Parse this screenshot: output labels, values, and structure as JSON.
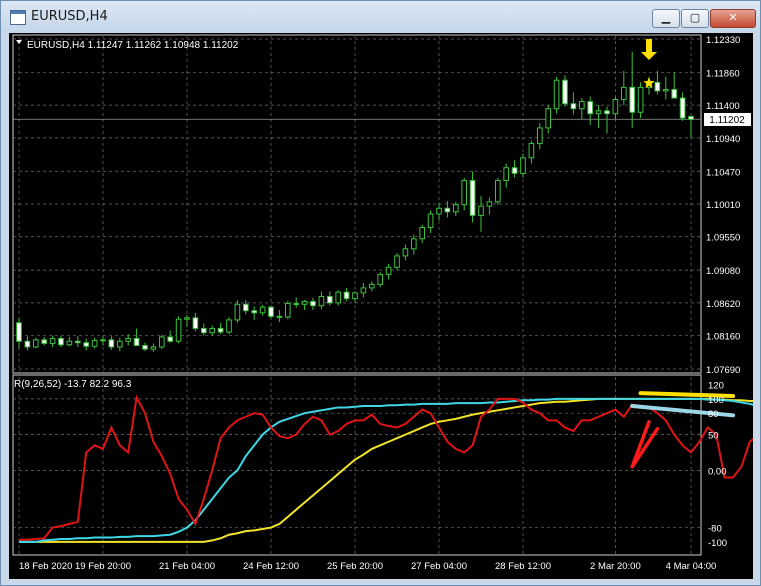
{
  "window": {
    "title": "EURUSD,H4",
    "buttons": {
      "minimize": "▁",
      "maximize": "▢",
      "close": "✕"
    }
  },
  "price_chart": {
    "info": "EURUSD,H4  1.11247 1.11262 1.10948 1.11202",
    "current_price": "1.11202",
    "axis_ticks": [
      "1.12330",
      "1.11860",
      "1.11400",
      "1.10940",
      "1.10470",
      "1.10010",
      "1.09550",
      "1.09080",
      "1.08620",
      "1.08160",
      "1.07690"
    ]
  },
  "indicator": {
    "label": "R(9,26,52) -13.7 82.2 96.3",
    "axis_ticks": [
      "120",
      "100",
      "80",
      "50",
      "0.00",
      "-80",
      "-100"
    ]
  },
  "time_axis": [
    "18 Feb 2020",
    "19 Feb 20:00",
    "21 Feb 04:00",
    "24 Feb 12:00",
    "25 Feb 20:00",
    "27 Feb 04:00",
    "28 Feb 12:00",
    "2 Mar 20:00",
    "4 Mar 04:00"
  ],
  "colors": {
    "background": "#000000",
    "grid": "#6f6f6f",
    "candles": "#3cc33c",
    "fast_line": "#e01414",
    "mid_line": "#3fd6e6",
    "slow_line": "#f0e32a",
    "annotation_yellow": "#ffe000",
    "annotation_blue": "#9cd7e8",
    "annotation_red": "#ff1a1a"
  },
  "chart_data": {
    "type": "line",
    "title": "EURUSD,H4",
    "ohlc_header": {
      "open": 1.11247,
      "high": 1.11262,
      "low": 1.10948,
      "close": 1.11202
    },
    "price_axis": {
      "ylim": [
        1.0769,
        1.1233
      ]
    },
    "candles": [
      [
        1.0834,
        1.0841,
        1.0798,
        1.0808
      ],
      [
        1.0808,
        1.0815,
        1.0795,
        1.08
      ],
      [
        1.08,
        1.0813,
        1.0798,
        1.081
      ],
      [
        1.081,
        1.0814,
        1.0802,
        1.0805
      ],
      [
        1.0805,
        1.0816,
        1.08,
        1.0812
      ],
      [
        1.0812,
        1.0816,
        1.08,
        1.0803
      ],
      [
        1.0803,
        1.0814,
        1.0801,
        1.0808
      ],
      [
        1.0808,
        1.0815,
        1.08,
        1.0806
      ],
      [
        1.0806,
        1.0812,
        1.0795,
        1.0801
      ],
      [
        1.0801,
        1.0813,
        1.0798,
        1.0809
      ],
      [
        1.0809,
        1.0815,
        1.0802,
        1.081
      ],
      [
        1.081,
        1.0815,
        1.0796,
        1.08
      ],
      [
        1.08,
        1.0813,
        1.0794,
        1.0808
      ],
      [
        1.0808,
        1.0818,
        1.0802,
        1.0812
      ],
      [
        1.0812,
        1.0826,
        1.0806,
        1.0802
      ],
      [
        1.0802,
        1.0806,
        1.0794,
        1.0797
      ],
      [
        1.0797,
        1.0805,
        1.0793,
        1.08
      ],
      [
        1.08,
        1.0817,
        1.0797,
        1.0814
      ],
      [
        1.0814,
        1.0823,
        1.0806,
        1.0808
      ],
      [
        1.0808,
        1.0843,
        1.0805,
        1.0839
      ],
      [
        1.0839,
        1.0845,
        1.0828,
        1.0841
      ],
      [
        1.0841,
        1.0848,
        1.0822,
        1.0826
      ],
      [
        1.0826,
        1.0833,
        1.0816,
        1.082
      ],
      [
        1.082,
        1.083,
        1.0816,
        1.0826
      ],
      [
        1.0826,
        1.0834,
        1.0818,
        1.0821
      ],
      [
        1.0821,
        1.0842,
        1.0818,
        1.0838
      ],
      [
        1.0838,
        1.0866,
        1.0834,
        1.086
      ],
      [
        1.086,
        1.0866,
        1.0846,
        1.0851
      ],
      [
        1.0851,
        1.0857,
        1.0838,
        1.0848
      ],
      [
        1.0848,
        1.0859,
        1.0844,
        1.0856
      ],
      [
        1.0856,
        1.0857,
        1.084,
        1.0843
      ],
      [
        1.0843,
        1.0852,
        1.0835,
        1.0842
      ],
      [
        1.0842,
        1.0865,
        1.0839,
        1.0861
      ],
      [
        1.0861,
        1.087,
        1.0855,
        1.086
      ],
      [
        1.086,
        1.0866,
        1.0852,
        1.0864
      ],
      [
        1.0864,
        1.0869,
        1.0852,
        1.0858
      ],
      [
        1.0858,
        1.0878,
        1.0853,
        1.0871
      ],
      [
        1.0871,
        1.0878,
        1.0858,
        1.0862
      ],
      [
        1.0862,
        1.088,
        1.0858,
        1.0877
      ],
      [
        1.0877,
        1.0883,
        1.0864,
        1.0868
      ],
      [
        1.0868,
        1.0878,
        1.0862,
        1.0876
      ],
      [
        1.0876,
        1.089,
        1.087,
        1.0883
      ],
      [
        1.0883,
        1.0892,
        1.0878,
        1.0888
      ],
      [
        1.0888,
        1.0905,
        1.0884,
        1.0902
      ],
      [
        1.0902,
        1.0917,
        1.0895,
        1.0912
      ],
      [
        1.0912,
        1.0932,
        1.0908,
        1.0928
      ],
      [
        1.0928,
        1.0944,
        1.0922,
        1.0938
      ],
      [
        1.0938,
        1.0958,
        1.093,
        1.0952
      ],
      [
        1.0952,
        1.0972,
        1.0946,
        1.0968
      ],
      [
        1.0968,
        1.0992,
        1.096,
        1.0987
      ],
      [
        1.0987,
        1.1003,
        1.0978,
        1.0995
      ],
      [
        1.0995,
        1.1005,
        1.0982,
        1.099
      ],
      [
        1.099,
        1.1004,
        1.0984,
        1.1
      ],
      [
        1.1,
        1.1038,
        1.0992,
        1.1034
      ],
      [
        1.1034,
        1.1047,
        1.0975,
        1.0985
      ],
      [
        1.0985,
        1.1012,
        1.0962,
        1.0998
      ],
      [
        1.0998,
        1.101,
        1.0986,
        1.1004
      ],
      [
        1.1004,
        1.1038,
        1.1,
        1.1034
      ],
      [
        1.1034,
        1.1058,
        1.1024,
        1.1052
      ],
      [
        1.1052,
        1.1063,
        1.1038,
        1.1044
      ],
      [
        1.1044,
        1.1072,
        1.1038,
        1.1066
      ],
      [
        1.1066,
        1.109,
        1.1058,
        1.1086
      ],
      [
        1.1086,
        1.1115,
        1.1078,
        1.1108
      ],
      [
        1.1108,
        1.114,
        1.11,
        1.1135
      ],
      [
        1.1135,
        1.118,
        1.1128,
        1.1175
      ],
      [
        1.1175,
        1.1182,
        1.1138,
        1.1142
      ],
      [
        1.1142,
        1.1158,
        1.1127,
        1.1135
      ],
      [
        1.1135,
        1.115,
        1.112,
        1.1145
      ],
      [
        1.1145,
        1.1152,
        1.1112,
        1.1128
      ],
      [
        1.1128,
        1.114,
        1.1108,
        1.1132
      ],
      [
        1.1132,
        1.1138,
        1.11,
        1.1128
      ],
      [
        1.1128,
        1.1152,
        1.112,
        1.1148
      ],
      [
        1.1148,
        1.1188,
        1.114,
        1.1165
      ],
      [
        1.1165,
        1.1215,
        1.1108,
        1.113
      ],
      [
        1.113,
        1.1172,
        1.1122,
        1.1165
      ],
      [
        1.1165,
        1.118,
        1.1155,
        1.1172
      ],
      [
        1.1172,
        1.1188,
        1.1155,
        1.116
      ],
      [
        1.116,
        1.118,
        1.1148,
        1.1162
      ],
      [
        1.1162,
        1.1186,
        1.115,
        1.115
      ],
      [
        1.115,
        1.1158,
        1.1118,
        1.1122
      ],
      [
        1.1124,
        1.1126,
        1.1095,
        1.112
      ]
    ],
    "indicator_axis": {
      "ylim": [
        -110,
        125
      ]
    },
    "series": [
      {
        "color": "#e01414",
        "values": [
          -97,
          -97,
          -96,
          -95,
          -80,
          -78,
          -75,
          -72,
          25,
          35,
          30,
          60,
          35,
          25,
          102,
          80,
          40,
          20,
          -5,
          -40,
          -55,
          -75,
          -40,
          0,
          45,
          60,
          70,
          75,
          80,
          78,
          60,
          48,
          45,
          50,
          65,
          75,
          70,
          50,
          55,
          65,
          70,
          70,
          78,
          65,
          62,
          60,
          65,
          75,
          85,
          80,
          60,
          40,
          30,
          25,
          35,
          75,
          85,
          100,
          100,
          100,
          95,
          85,
          80,
          70,
          70,
          60,
          55,
          70,
          70,
          75,
          80,
          85,
          75,
          92,
          90,
          88,
          80,
          70,
          50,
          35,
          25,
          40,
          60,
          50,
          -10,
          -10,
          5,
          40,
          50,
          48,
          45,
          25,
          -10
        ]
      },
      {
        "color": "#3fd6e6",
        "values": [
          -100,
          -100,
          -100,
          -98,
          -97,
          -96,
          -96,
          -95,
          -95,
          -94,
          -94,
          -94,
          -93,
          -93,
          -92,
          -92,
          -92,
          -91,
          -90,
          -86,
          -80,
          -70,
          -55,
          -40,
          -25,
          -10,
          0,
          20,
          35,
          50,
          60,
          68,
          72,
          76,
          80,
          82,
          84,
          86,
          88,
          88,
          89,
          90,
          90,
          90,
          91,
          91,
          92,
          92,
          93,
          93,
          93,
          93,
          94,
          94,
          94,
          94,
          95,
          95,
          96,
          97,
          98,
          98,
          99,
          99,
          100,
          100,
          100,
          100,
          100,
          100,
          100,
          100,
          100,
          100,
          100,
          100,
          100,
          100,
          100,
          100,
          100,
          100,
          99,
          99,
          98,
          97,
          95,
          93,
          90,
          85,
          82
        ]
      },
      {
        "color": "#f0e32a",
        "values": [
          -100,
          -100,
          -100,
          -100,
          -100,
          -100,
          -100,
          -100,
          -100,
          -100,
          -100,
          -100,
          -100,
          -100,
          -100,
          -100,
          -100,
          -100,
          -100,
          -100,
          -100,
          -100,
          -100,
          -98,
          -95,
          -90,
          -88,
          -85,
          -84,
          -82,
          -80,
          -75,
          -65,
          -55,
          -45,
          -35,
          -25,
          -15,
          -5,
          5,
          15,
          22,
          30,
          35,
          40,
          45,
          50,
          55,
          60,
          65,
          68,
          70,
          72,
          75,
          78,
          80,
          82,
          84,
          86,
          88,
          90,
          92,
          94,
          95,
          96,
          96,
          97,
          98,
          99,
          100,
          100,
          100,
          100,
          100,
          100,
          100,
          100,
          100,
          100,
          100,
          100,
          100,
          100,
          99,
          99,
          98,
          98,
          97,
          97,
          96,
          96
        ]
      }
    ],
    "annotations": {
      "down_arrow_candle": 75,
      "star": {
        "candle": 75,
        "price": 1.1171
      },
      "yellow_trend": {
        "from": [
          74,
          108
        ],
        "to": [
          85,
          104
        ]
      },
      "blue_trend": {
        "from": [
          73,
          90
        ],
        "to": [
          85,
          77
        ]
      },
      "red_v": [
        [
          75,
          68
        ],
        [
          73,
          5
        ],
        [
          76,
          58
        ]
      ]
    }
  }
}
